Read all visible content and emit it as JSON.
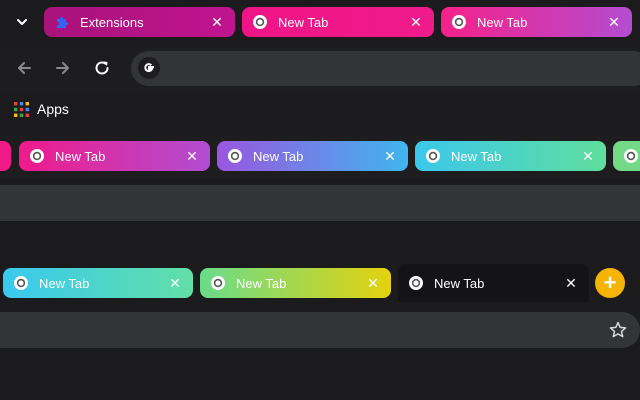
{
  "section1": {
    "tabs": [
      {
        "label": "Extensions",
        "icon": "puzzle-icon",
        "gradient": [
          "#a9127b",
          "#c0148f"
        ]
      },
      {
        "label": "New Tab",
        "icon": "chrome-icon",
        "gradient": [
          "#f01586",
          "#ef1a8c"
        ]
      },
      {
        "label": "New Tab",
        "icon": "chrome-icon",
        "gradient": [
          "#f5218a",
          "#b34dd0"
        ]
      }
    ],
    "close_glyph": "✕",
    "bookmarks": {
      "apps_label": "Apps"
    }
  },
  "section2": {
    "tabs": [
      {
        "label": "New Tab",
        "gradient": [
          "#f01a8a",
          "#b14ed2"
        ]
      },
      {
        "label": "New Tab",
        "gradient": [
          "#9a56e0",
          "#3fb6ee"
        ]
      },
      {
        "label": "New Tab",
        "gradient": [
          "#3bc8ec",
          "#5fde9d"
        ]
      }
    ],
    "close_glyph": "✕"
  },
  "section3": {
    "tabs": [
      {
        "label": "New Tab",
        "gradient": [
          "#39c9ef",
          "#62dfa7"
        ]
      },
      {
        "label": "New Tab",
        "gradient": [
          "#69db8a",
          "#e4d20e"
        ]
      },
      {
        "label": "New Tab",
        "gradient": [
          "#141416",
          "#141416"
        ]
      }
    ],
    "close_glyph": "✕",
    "new_tab_glyph": "+"
  },
  "colors": {
    "background": "#1b1b1d",
    "omnibox": "#333437",
    "active_tab": "#141416",
    "new_tab_button": "#f4b400"
  }
}
